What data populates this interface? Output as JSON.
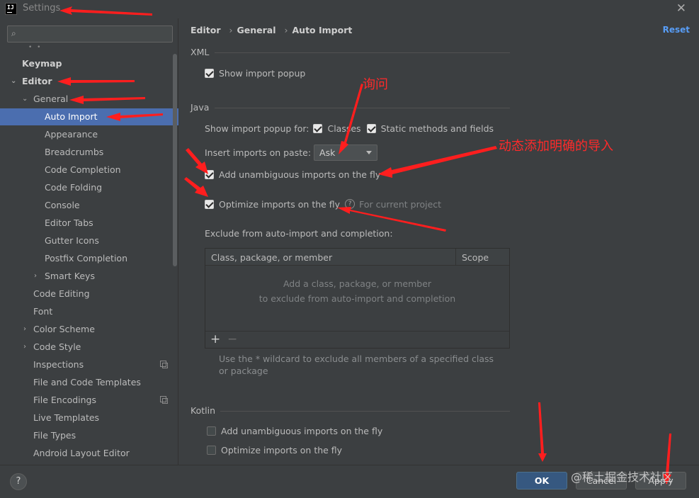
{
  "window": {
    "title": "Settings",
    "logo_text": "IJ"
  },
  "search": {
    "placeholder": "",
    "value": ""
  },
  "sidebar": {
    "items": [
      {
        "label": "Keymap"
      },
      {
        "label": "Editor"
      },
      {
        "label": "General"
      },
      {
        "label": "Auto Import"
      },
      {
        "label": "Appearance"
      },
      {
        "label": "Breadcrumbs"
      },
      {
        "label": "Code Completion"
      },
      {
        "label": "Code Folding"
      },
      {
        "label": "Console"
      },
      {
        "label": "Editor Tabs"
      },
      {
        "label": "Gutter Icons"
      },
      {
        "label": "Postfix Completion"
      },
      {
        "label": "Smart Keys"
      },
      {
        "label": "Code Editing"
      },
      {
        "label": "Font"
      },
      {
        "label": "Color Scheme"
      },
      {
        "label": "Code Style"
      },
      {
        "label": "Inspections"
      },
      {
        "label": "File and Code Templates"
      },
      {
        "label": "File Encodings"
      },
      {
        "label": "Live Templates"
      },
      {
        "label": "File Types"
      },
      {
        "label": "Android Layout Editor"
      }
    ]
  },
  "breadcrumb": {
    "items": [
      "Editor",
      "General",
      "Auto Import"
    ],
    "reset": "Reset"
  },
  "xml": {
    "title": "XML",
    "show_import_popup": {
      "label": "Show import popup",
      "checked": true
    }
  },
  "java": {
    "title": "Java",
    "show_popup_for_label": "Show import popup for:",
    "classes": {
      "label": "Classes",
      "checked": true
    },
    "static_methods": {
      "label": "Static methods and fields",
      "checked": true
    },
    "insert_on_paste_label": "Insert imports on paste:",
    "insert_on_paste_value": "Ask",
    "add_unambiguous": {
      "label": "Add unambiguous imports on the fly",
      "checked": true
    },
    "optimize": {
      "label": "Optimize imports on the fly",
      "checked": true,
      "note": "For current project"
    },
    "exclude_label": "Exclude from auto-import and completion:",
    "table": {
      "col_class": "Class, package, or member",
      "col_scope": "Scope",
      "empty_line1": "Add a class, package, or member",
      "empty_line2": "to exclude from auto-import and completion"
    },
    "hint": "Use the * wildcard to exclude all members of a specified class or package"
  },
  "kotlin": {
    "title": "Kotlin",
    "add_unambiguous": {
      "label": "Add unambiguous imports on the fly",
      "checked": false
    },
    "optimize": {
      "label": "Optimize imports on the fly",
      "checked": false
    }
  },
  "footer": {
    "help": "?",
    "ok": "OK",
    "cancel": "Cancel",
    "apply": "Apply"
  },
  "annotations": {
    "ask": "询问",
    "dynamic": "动态添加明确的导入",
    "color": "#ff2a2a"
  },
  "watermark": "@稀土掘金技术社区"
}
